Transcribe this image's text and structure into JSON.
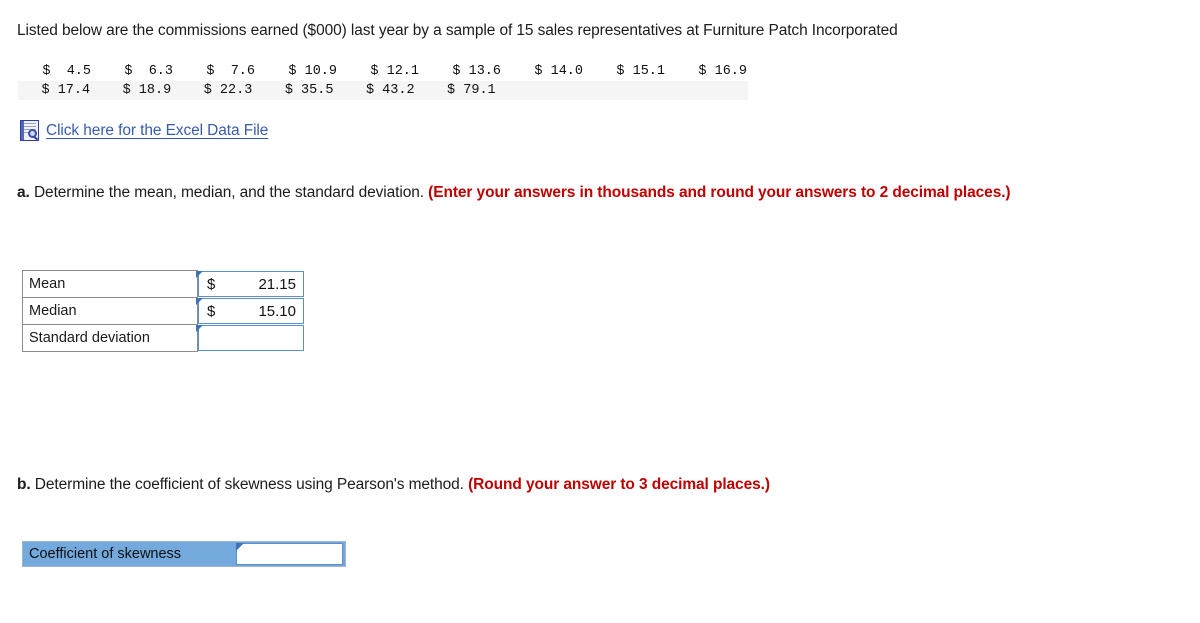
{
  "prompt": {
    "text": "Listed below are the commissions earned ($000) last year by a sample of 15 sales representatives at Furniture Patch Incorporated"
  },
  "data_values": {
    "row1": [
      "$  4.5",
      "$  6.3",
      "$  7.6",
      "$ 10.9",
      "$ 12.1",
      "$ 13.6",
      "$ 14.0",
      "$ 15.1",
      "$ 16.9"
    ],
    "row2": [
      "$ 17.4",
      "$ 18.9",
      "$ 22.3",
      "$ 35.5",
      "$ 43.2",
      "$ 79.1",
      "",
      "",
      ""
    ]
  },
  "excel_link": {
    "icon": "excel-file-icon",
    "label": "Click here for the Excel Data File",
    "color": "#3a5bab"
  },
  "question_a": {
    "letter": "a.",
    "text": "Determine the mean, median, and the standard deviation.",
    "hint": "(Enter your answers in thousands and round your answers to 2 decimal places.)",
    "hint_color": "#c00000"
  },
  "answers_a": {
    "rows": [
      {
        "label": "Mean",
        "currency": "$",
        "value": "21.15",
        "has_currency": true
      },
      {
        "label": "Median",
        "currency": "$",
        "value": "15.10",
        "has_currency": true
      },
      {
        "label": "Standard deviation",
        "currency": "",
        "value": "",
        "has_currency": false
      }
    ]
  },
  "question_b": {
    "letter": "b.",
    "text": "Determine the coefficient of skewness using Pearson's method.",
    "hint": "(Round your answer to 3 decimal places.)",
    "hint_color": "#c00000"
  },
  "answers_b": {
    "label": "Coefficient of skewness",
    "value": "",
    "label_background": "#74a9de"
  }
}
